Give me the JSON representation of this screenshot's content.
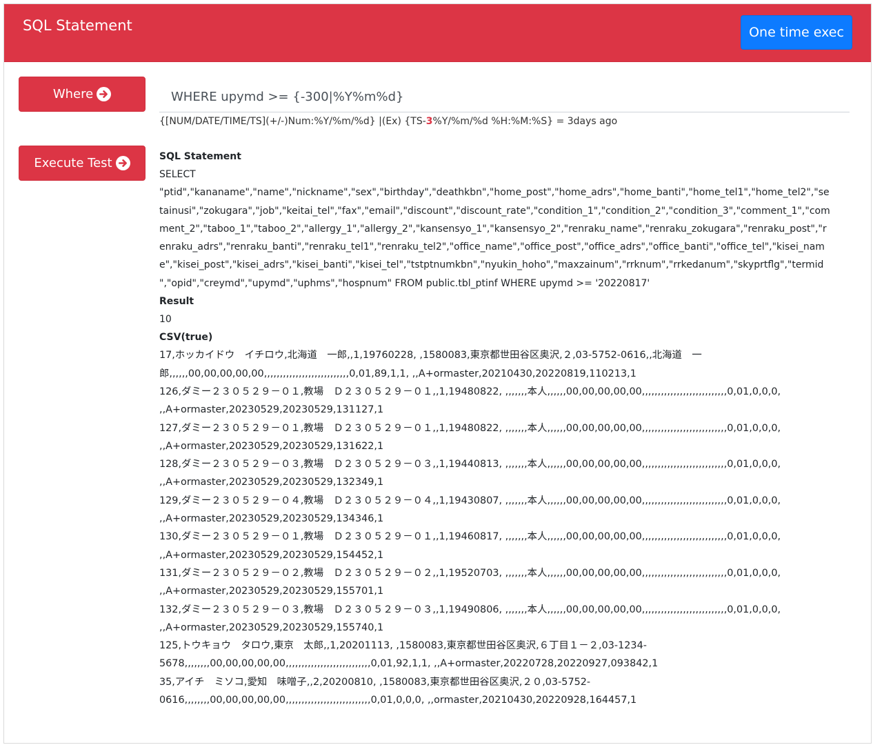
{
  "header": {
    "title": "SQL Statement",
    "exec_button": "One time exec"
  },
  "buttons": {
    "where": "Where",
    "execute_test": "Execute Test"
  },
  "where_field": {
    "value": "WHERE upymd >= {-300|%Y%m%d}"
  },
  "hint": {
    "prefix": "{[NUM/DATE/TIME/TS](+/-)Num:%Y/%m/%d} |(Ex) {TS-",
    "highlight": "3",
    "suffix": "%Y/%m/%d %H:%M:%S} = 3days ago"
  },
  "sql": {
    "label": "SQL Statement",
    "lines": [
      "SELECT",
      "\"ptid\",\"kananame\",\"name\",\"nickname\",\"sex\",\"birthday\",\"deathkbn\",\"home_post\",\"home_adrs\",\"home_banti\",\"home_tel1\",\"home_tel2\",\"se",
      "tainusi\",\"zokugara\",\"job\",\"keitai_tel\",\"fax\",\"email\",\"discount\",\"discount_rate\",\"condition_1\",\"condition_2\",\"condition_3\",\"comment_1\",\"com",
      "ment_2\",\"taboo_1\",\"taboo_2\",\"allergy_1\",\"allergy_2\",\"kansensyo_1\",\"kansensyo_2\",\"renraku_name\",\"renraku_zokugara\",\"renraku_post\",\"r",
      "enraku_adrs\",\"renraku_banti\",\"renraku_tel1\",\"renraku_tel2\",\"office_name\",\"office_post\",\"office_adrs\",\"office_banti\",\"office_tel\",\"kisei_nam",
      "e\",\"kisei_post\",\"kisei_adrs\",\"kisei_banti\",\"kisei_tel\",\"tstptnumkbn\",\"nyukin_hoho\",\"maxzainum\",\"rrknum\",\"rrkedanum\",\"skyprtflg\",\"termid",
      "\",\"opid\",\"creymd\",\"upymd\",\"uphms\",\"hospnum\" FROM public.tbl_ptinf WHERE upymd >= '20220817'"
    ]
  },
  "result": {
    "label": "Result",
    "value": "10"
  },
  "csv": {
    "label": "CSV(true)",
    "lines": [
      "17,ホッカイドウ　イチロウ,北海道　一郎,,1,19760228, ,1580083,東京都世田谷区奥沢,２,03-5752-0616,,北海道　一",
      "郎,,,,,,00,00,00,00,00,,,,,,,,,,,,,,,,,,,,,,,,,,,0,01,89,1,1, ,,A+ormaster,20210430,20220819,110213,1",
      "126,ダミー２３０５２９－０１,教場　Ｄ２３０５２９－０１,,1,19480822, ,,,,,,,本人,,,,,,00,00,00,00,00,,,,,,,,,,,,,,,,,,,,,,,,,,,0,01,0,0,0,",
      ",,A+ormaster,20230529,20230529,131127,1",
      "127,ダミー２３０５２９－０１,教場　Ｄ２３０５２９－０１,,1,19480822, ,,,,,,,本人,,,,,,00,00,00,00,00,,,,,,,,,,,,,,,,,,,,,,,,,,,0,01,0,0,0,",
      ",,A+ormaster,20230529,20230529,131622,1",
      "128,ダミー２３０５２９－０３,教場　Ｄ２３０５２９－０３,,1,19440813, ,,,,,,,本人,,,,,,00,00,00,00,00,,,,,,,,,,,,,,,,,,,,,,,,,,,0,01,0,0,0,",
      ",,A+ormaster,20230529,20230529,132349,1",
      "129,ダミー２３０５２９－０４,教場　Ｄ２３０５２９－０４,,1,19430807, ,,,,,,,本人,,,,,,00,00,00,00,00,,,,,,,,,,,,,,,,,,,,,,,,,,,0,01,0,0,0,",
      ",,A+ormaster,20230529,20230529,134346,1",
      "130,ダミー２３０５２９－０１,教場　Ｄ２３０５２９－０１,,1,19460817, ,,,,,,,本人,,,,,,00,00,00,00,00,,,,,,,,,,,,,,,,,,,,,,,,,,,0,01,0,0,0,",
      ",,A+ormaster,20230529,20230529,154452,1",
      "131,ダミー２３０５２９－０２,教場　Ｄ２３０５２９－０２,,1,19520703, ,,,,,,,本人,,,,,,00,00,00,00,00,,,,,,,,,,,,,,,,,,,,,,,,,,,0,01,0,0,0,",
      ",,A+ormaster,20230529,20230529,155701,1",
      "132,ダミー２３０５２９－０３,教場　Ｄ２３０５２９－０３,,1,19490806, ,,,,,,,本人,,,,,,00,00,00,00,00,,,,,,,,,,,,,,,,,,,,,,,,,,,0,01,0,0,0,",
      ",,A+ormaster,20230529,20230529,155740,1",
      "125,トウキョウ　タロウ,東京　太郎,,1,20201113, ,1580083,東京都世田谷区奥沢,６丁目１－２,03-1234-",
      "5678,,,,,,,,00,00,00,00,00,,,,,,,,,,,,,,,,,,,,,,,,,,,0,01,92,1,1, ,,A+ormaster,20220728,20220927,093842,1",
      "35,アイチ　ミソコ,愛知　味噌子,,2,20200810, ,1580083,東京都世田谷区奥沢,２０,03-5752-",
      "0616,,,,,,,,00,00,00,00,00,,,,,,,,,,,,,,,,,,,,,,,,,,,0,01,0,0,0, ,,ormaster,20210430,20220928,164457,1"
    ]
  },
  "colors": {
    "header_bg": "#dc3545",
    "primary_button": "#0d7bff",
    "danger_button": "#dc3545"
  },
  "icons": {
    "where": "arrow-circle-right-icon",
    "execute_test": "arrow-circle-right-icon"
  }
}
